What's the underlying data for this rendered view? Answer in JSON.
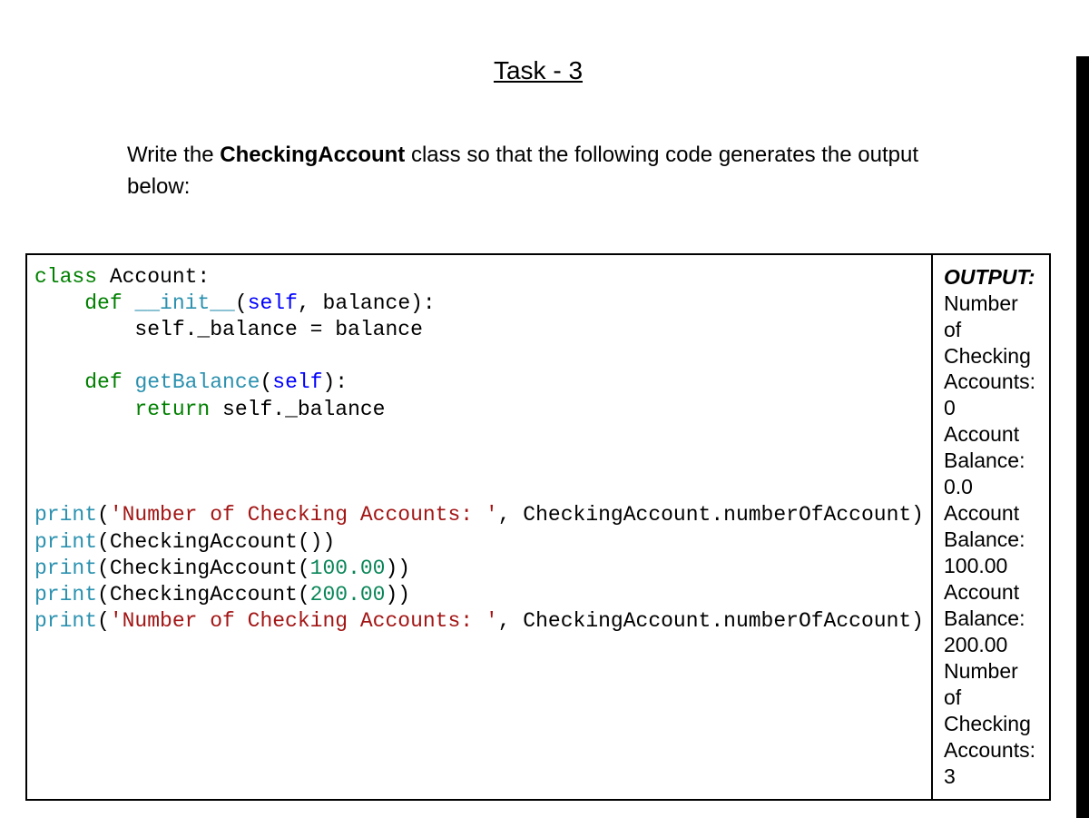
{
  "title": "Task - 3",
  "instructions": {
    "prefix": "Write the ",
    "class_name": "CheckingAccount",
    "suffix": " class so that the following code generates the output below:"
  },
  "code": {
    "kw_class": "class",
    "class_name": " Account:",
    "indent1": "    ",
    "kw_def1": "def",
    "init_name": " __init__",
    "init_params_open": "(",
    "self1": "self",
    "init_params_rest": ", balance):",
    "indent2": "        ",
    "init_body": "self._balance = balance",
    "kw_def2": "def",
    "get_balance_name": " getBalance",
    "get_balance_params_open": "(",
    "self2": "self",
    "get_balance_params_close": "):",
    "kw_return": "return",
    "return_body": " self._balance",
    "print1_fn": "print",
    "print1_open": "(",
    "print1_str": "'Number of Checking Accounts: '",
    "print1_rest": ", CheckingAccount.numberOfAccount)",
    "print2_fn": "print",
    "print2_body": "(CheckingAccount())",
    "print3_fn": "print",
    "print3_open": "(CheckingAccount(",
    "print3_num": "100.00",
    "print3_close": "))",
    "print4_fn": "print",
    "print4_open": "(CheckingAccount(",
    "print4_num": "200.00",
    "print4_close": "))",
    "print5_fn": "print",
    "print5_open": "(",
    "print5_str": "'Number of Checking Accounts: '",
    "print5_rest": ", CheckingAccount.numberOfAccount)"
  },
  "output": {
    "heading": "OUTPUT:",
    "line1": "Number of Checking Accounts: 0",
    "line2": "Account Balance: 0.0",
    "line3": "Account Balance: 100.00",
    "line4": "Account Balance: 200.00",
    "line5": "Number of Checking Accounts: 3"
  }
}
